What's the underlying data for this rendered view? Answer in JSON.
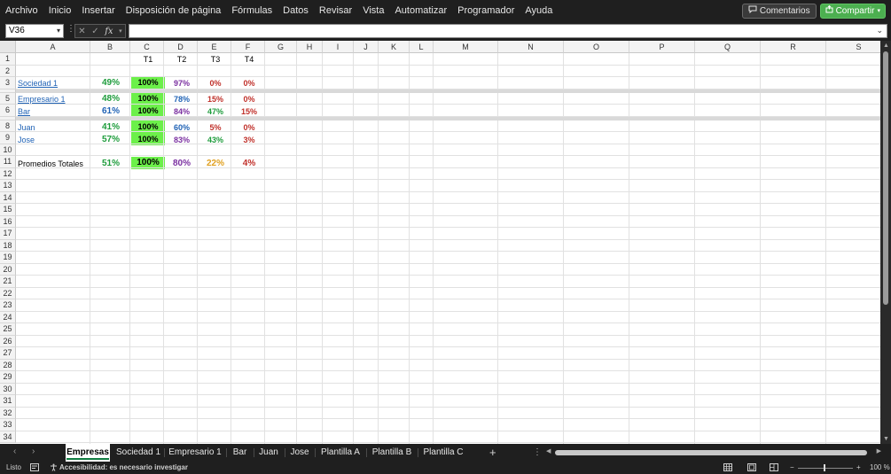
{
  "menu": {
    "items": [
      "Archivo",
      "Inicio",
      "Insertar",
      "Disposición de página",
      "Fórmulas",
      "Datos",
      "Revisar",
      "Vista",
      "Automatizar",
      "Programador",
      "Ayuda"
    ],
    "comments_label": "Comentarios",
    "share_label": "Compartir"
  },
  "formula_bar": {
    "name_box": "V36",
    "fx_label": "fx",
    "formula": ""
  },
  "grid": {
    "columns": [
      "A",
      "B",
      "C",
      "D",
      "E",
      "F",
      "G",
      "H",
      "I",
      "J",
      "K",
      "L",
      "M",
      "N",
      "O",
      "P",
      "Q",
      "R",
      "S"
    ],
    "rows": [
      "1",
      "2",
      "3",
      "4",
      "5",
      "6",
      "7",
      "8",
      "9",
      "10",
      "11",
      "12",
      "13",
      "14",
      "15",
      "16",
      "17",
      "18",
      "19",
      "20",
      "21",
      "22",
      "23",
      "24",
      "25",
      "26",
      "27",
      "28",
      "29",
      "30",
      "31",
      "32",
      "33",
      "34"
    ]
  },
  "cells": {
    "c1": "T1",
    "d1": "T2",
    "e1": "T3",
    "f1": "T4",
    "a3": "Sociedad 1",
    "b3": "49%",
    "c3": "100%",
    "d3": "97%",
    "e3": "0%",
    "f3": "0%",
    "a5": "Empresario 1",
    "b5": "48%",
    "c5": "100%",
    "d5": "78%",
    "e5": "15%",
    "f5": "0%",
    "a6": "Bar",
    "b6": "61%",
    "c6": "100%",
    "d6": "84%",
    "e6": "47%",
    "f6": "15%",
    "a8": "Juan",
    "b8": "41%",
    "c8": "100%",
    "d8": "60%",
    "e8": "5%",
    "f8": "0%",
    "a9": "Jose",
    "b9": "57%",
    "c9": "100%",
    "d9": "83%",
    "e9": "43%",
    "f9": "3%",
    "a11": "Promedios Totales",
    "b11": "51%",
    "c11": "100%",
    "d11": "80%",
    "e11": "22%",
    "f11": "4%"
  },
  "colors": {
    "green_text": "#1e9c3c",
    "blue_text": "#1f62b5",
    "purple_text": "#7a2fa0",
    "red_text": "#c0302a",
    "orange_text": "#e0a020",
    "highlight_fill": "#6cf04a"
  },
  "sheets": {
    "tabs": [
      "Empresas",
      "Sociedad 1",
      "Empresario 1",
      "Bar",
      "Juan",
      "Jose",
      "Plantilla A",
      "Plantilla B",
      "Plantilla C"
    ],
    "active": "Empresas",
    "add_label": "+",
    "more_label": "⋮"
  },
  "status": {
    "ready": "Listo",
    "accessibility": "Accesibilidad: es necesario investigar",
    "zoom": "100 %",
    "zoom_minus": "−",
    "zoom_plus": "+"
  },
  "icons": {
    "name_box_dropdown": "chevron-down-icon",
    "cancel": "close-icon",
    "enter": "check-icon",
    "comments": "comment-icon",
    "share": "share-icon",
    "accessibility": "accessibility-icon"
  }
}
